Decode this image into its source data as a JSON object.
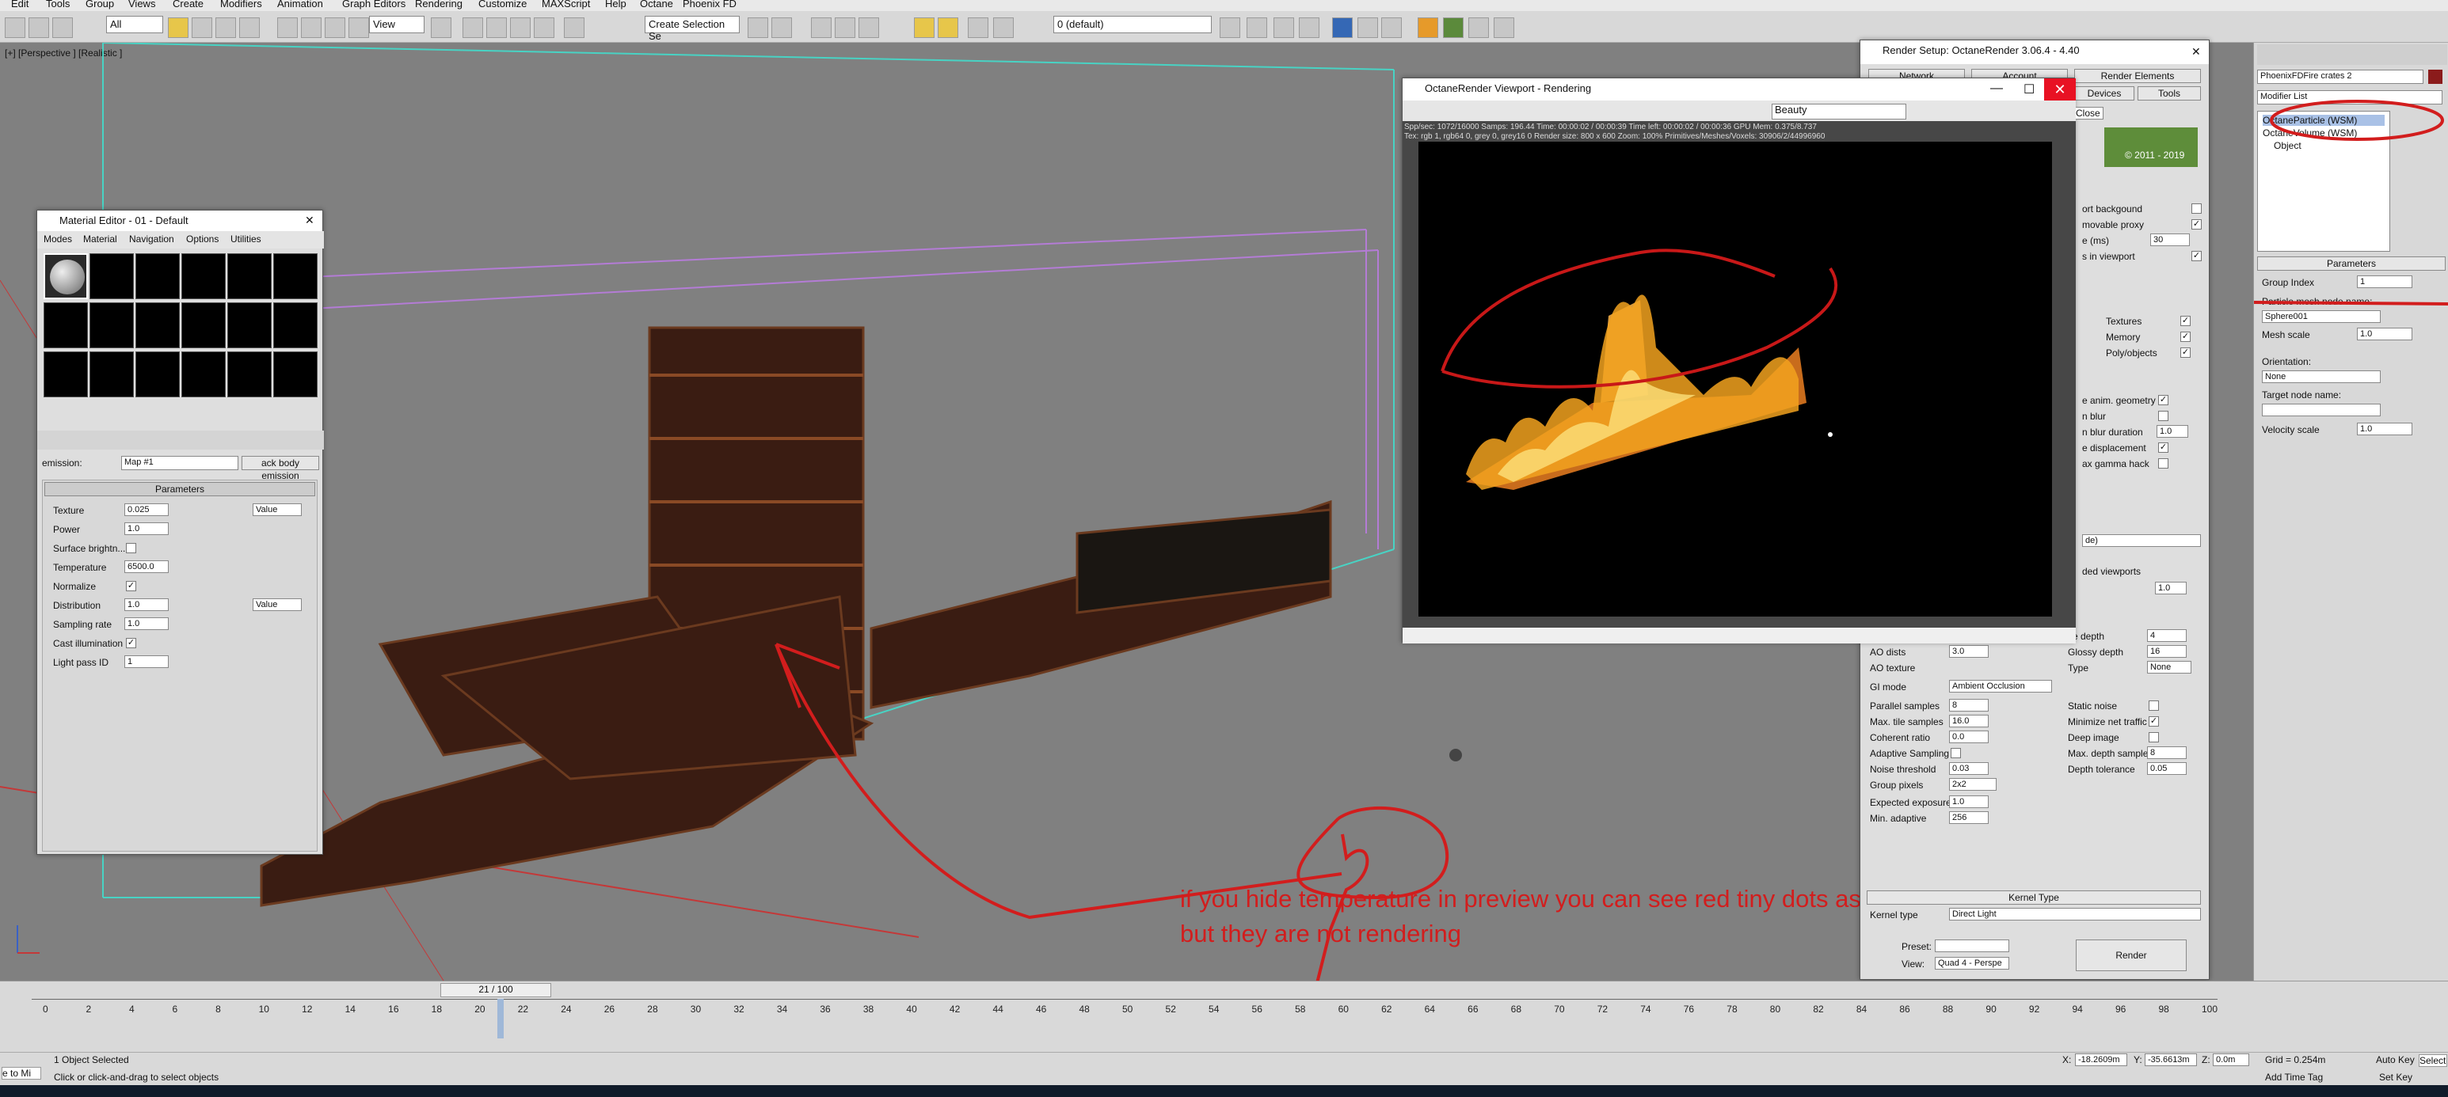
{
  "menubar": [
    "Edit",
    "Tools",
    "Group",
    "Views",
    "Create",
    "Modifiers",
    "Animation",
    "Graph Editors",
    "Rendering",
    "Customize",
    "MAXScript",
    "Help",
    "Octane",
    "Phoenix FD"
  ],
  "toolbar": {
    "filter": "All",
    "view": "View",
    "named_selection": "Create Selection Se",
    "layer": "0 (default)"
  },
  "viewport": {
    "label": "[+] [Perspective ] [Realistic ]"
  },
  "material_editor": {
    "title": "Material Editor - 01 - Default",
    "menu": [
      "Modes",
      "Material",
      "Navigation",
      "Options",
      "Utilities"
    ],
    "emission_label": "emission:",
    "map_name": "Map #1",
    "type_button": "ack body emission",
    "rollout": "Parameters",
    "params": [
      {
        "label": "Texture",
        "value": "0.025",
        "extra": "Value"
      },
      {
        "label": "Power",
        "value": "1.0",
        "extra": ""
      },
      {
        "label": "Surface brightn...",
        "value": "",
        "extra": ""
      },
      {
        "label": "Temperature",
        "value": "6500.0",
        "extra": ""
      },
      {
        "label": "Normalize",
        "value": "✓",
        "extra": ""
      },
      {
        "label": "Distribution",
        "value": "1.0",
        "extra": "Value"
      },
      {
        "label": "Sampling rate",
        "value": "1.0",
        "extra": ""
      },
      {
        "label": "Cast illumination",
        "value": "✓",
        "extra": ""
      },
      {
        "label": "Light pass ID",
        "value": "1",
        "extra": ""
      }
    ]
  },
  "octane_viewport": {
    "title": "OctaneRender Viewport - Rendering",
    "pass": "Beauty",
    "stats1": "Spp/sec: 1072/16000   Samps: 196.44   Time: 00:00:02 / 00:00:39   Time left: 00:00:02 / 00:00:36   GPU Mem: 0.375/8.737",
    "stats2": "Tex: rgb 1, rgb64 0, grey 0, grey16 0   Render size: 800 x 600   Zoom: 100%   Primitives/Meshes/Voxels: 30906/2/44996960",
    "close_tooltip": "Close"
  },
  "render_setup": {
    "title": "Render Setup: OctaneRender 3.06.4 - 4.40",
    "tabs_top": [
      "Network",
      "Account",
      "Render Elements"
    ],
    "tabs_bottom": [
      "Devices",
      "Tools"
    ],
    "splash": "© 2011 - 2019",
    "options_upper": [
      {
        "label": "ort backgound",
        "value": ""
      },
      {
        "label": "movable proxy",
        "value": "✓"
      },
      {
        "label": "e (ms)",
        "value": "30"
      },
      {
        "label": "s in viewport",
        "value": "✓"
      }
    ],
    "mem_rows": [
      {
        "label": "Textures",
        "value": "✓"
      },
      {
        "label": "Memory",
        "value": "✓"
      },
      {
        "label": "Poly/objects",
        "value": "✓"
      }
    ],
    "motion_rows": [
      {
        "label": "e anim. geometry",
        "value": "✓"
      },
      {
        "label": "n blur",
        "value": ""
      },
      {
        "label": "n blur duration",
        "value": "1.0"
      },
      {
        "label": "e displacement",
        "value": "✓"
      },
      {
        "label": "ax gamma hack",
        "value": ""
      }
    ],
    "misc_dropdown": "de)",
    "viewports_label": "ded viewports",
    "viewports_value": "1.0",
    "kernel_left": [
      {
        "label": "AO dists",
        "value": "3.0"
      },
      {
        "label": "AO texture",
        "value": ""
      },
      {
        "label": "GI mode",
        "value": "Ambient Occlusion"
      },
      {
        "label": "Parallel samples",
        "value": "8"
      },
      {
        "label": "Max. tile samples",
        "value": "16.0"
      },
      {
        "label": "Coherent ratio",
        "value": "0.0"
      },
      {
        "label": "Adaptive Sampling",
        "value": ""
      },
      {
        "label": "Noise threshold",
        "value": "0.03"
      },
      {
        "label": "Group pixels",
        "value": "2x2"
      },
      {
        "label": "Expected exposure",
        "value": "1.0"
      },
      {
        "label": "Min. adaptive",
        "value": "256"
      }
    ],
    "kernel_right": [
      {
        "label": "se depth",
        "value": "4"
      },
      {
        "label": "Glossy depth",
        "value": "16"
      },
      {
        "label": "Type",
        "value": "None"
      },
      {
        "label": "Static noise",
        "value": ""
      },
      {
        "label": "Minimize net traffic",
        "value": "✓"
      },
      {
        "label": "Deep image",
        "value": ""
      },
      {
        "label": "Max. depth samples",
        "value": "8"
      },
      {
        "label": "Depth tolerance",
        "value": "0.05"
      }
    ],
    "kernel_type_header": "Kernel Type",
    "kernel_type_label": "Kernel type",
    "kernel_type_value": "Direct Light",
    "preset_label": "Preset:",
    "view_label": "View:",
    "view_value": "Quad 4 - Perspe",
    "render_button": "Render"
  },
  "command_panel": {
    "object_name": "PhoenixFDFire crates 2",
    "modifier_list": "Modifier List",
    "stack": [
      "OctaneParticle (WSM)",
      "OctaneVolume (WSM)",
      "Object"
    ],
    "rollout": "Parameters",
    "group_index_label": "Group Index",
    "group_index": "1",
    "node_label": "Particle mesh node name:",
    "node_value": "Sphere001",
    "mesh_scale_label": "Mesh scale",
    "mesh_scale": "1.0",
    "orientation_label": "Orientation:",
    "orientation_value": "None",
    "target_label": "Target node name:",
    "velocity_label": "Velocity scale",
    "velocity_value": "1.0"
  },
  "timeline": {
    "frame": "21 / 100",
    "ticks": [
      "0",
      "2",
      "4",
      "6",
      "8",
      "10",
      "12",
      "14",
      "16",
      "18",
      "20",
      "22",
      "24",
      "26",
      "28",
      "30",
      "32",
      "34",
      "36",
      "38",
      "40",
      "42",
      "44",
      "46",
      "48",
      "50",
      "52",
      "54",
      "56",
      "58",
      "60",
      "62",
      "64",
      "66",
      "68",
      "70",
      "72",
      "74",
      "76",
      "78",
      "80",
      "82",
      "84",
      "86",
      "88",
      "90",
      "92",
      "94",
      "96",
      "98",
      "100"
    ]
  },
  "status": {
    "selected": "1 Object Selected",
    "hint": "Click or click-and-drag to select objects",
    "x_label": "X:",
    "x": "-18.2609m",
    "y_label": "Y:",
    "y": "-35.6613m",
    "z_label": "Z:",
    "z": "0.0m",
    "grid": "Grid = 0.254m",
    "auto_key": "Auto Key",
    "set_key": "Set Key",
    "selected_btn": "Selecte",
    "add_time_tag": "Add Time Tag",
    "maxscript": "e to Mi"
  },
  "annotation": {
    "line1": "if you hide temperature in preview you can see red tiny dots as sparks",
    "line2": "but they are not rendering"
  }
}
